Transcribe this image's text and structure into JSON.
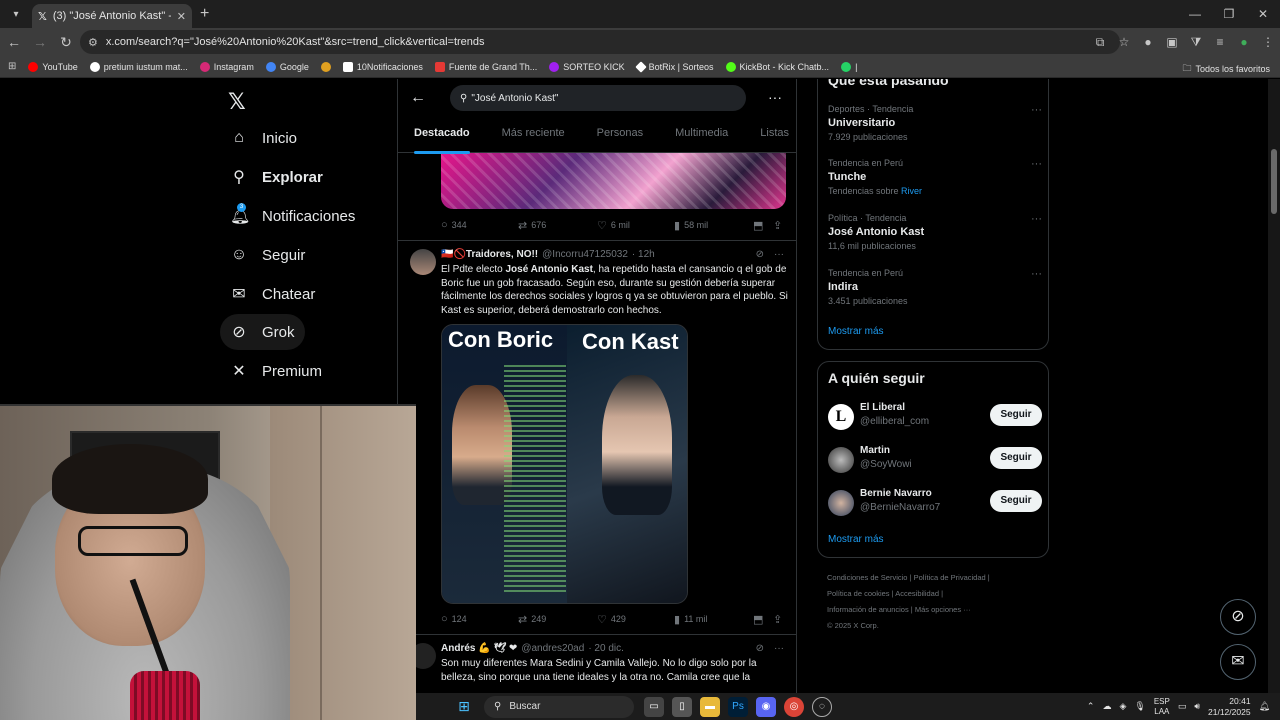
{
  "browser": {
    "tab_title": "(3) \"José Antonio Kast\" - Buscar",
    "url": "x.com/search?q=\"José%20Antonio%20Kast\"&src=trend_click&vertical=trends",
    "bookmarks": [
      "YouTube",
      "pretium iustum mat...",
      "Instagram",
      "Google",
      "10Notificaciones",
      "Fuente de Grand Th...",
      "SORTEO KICK",
      "BotRix | Sorteos",
      "KickBot - Kick Chatb..."
    ],
    "all_favorites": "Todos los favoritos"
  },
  "nav": {
    "items": [
      {
        "label": "Inicio",
        "icon": "home-icon"
      },
      {
        "label": "Explorar",
        "icon": "search-icon"
      },
      {
        "label": "Notificaciones",
        "icon": "bell-icon"
      },
      {
        "label": "Seguir",
        "icon": "follow-icon"
      },
      {
        "label": "Chatear",
        "icon": "mail-icon"
      },
      {
        "label": "Grok",
        "icon": "grok-icon"
      },
      {
        "label": "Premium",
        "icon": "x-icon"
      }
    ],
    "notif_count": "3"
  },
  "search": {
    "query": "\"José Antonio Kast\"",
    "tabs": [
      "Destacado",
      "Más reciente",
      "Personas",
      "Multimedia",
      "Listas"
    ]
  },
  "tweets": [
    {
      "replies": "344",
      "retweets": "676",
      "likes": "6 mil",
      "views": "58 mil"
    },
    {
      "name": "🇨🇱🚫Traidores, NO!!",
      "handle": "@Incorru47125032",
      "time": "· 12h",
      "text_pre": "El Pdte electo ",
      "text_bold": "José Antonio Kast",
      "text_post": ",  ha repetido hasta el cansancio q el gob de Boric fue un gob fracasado. Según eso, durante su gestión debería superar fácilmente los derechos sociales y logros q ya se obtuvieron para el pueblo. Si Kast es superior, deberá demostrarlo con hechos.",
      "media_left": "Con Boric",
      "media_right": "Con Kast",
      "replies": "124",
      "retweets": "249",
      "likes": "429",
      "views": "11 mil"
    },
    {
      "name": "Andrés 💪 🕊 ❤",
      "handle": "@andres20ad",
      "time": "· 20 dic.",
      "text": "Son muy diferentes Mara Sedini y Camila Vallejo. No lo digo solo por la belleza, sino porque una tiene ideales y la otra no. Camila cree que la"
    }
  ],
  "trends": {
    "title": "Qué está pasando",
    "items": [
      {
        "meta": "Deportes · Tendencia",
        "title": "Universitario",
        "count": "7.929 publicaciones"
      },
      {
        "meta": "Tendencia en Perú",
        "title": "Tunche",
        "count": "Tendencias sobre ",
        "link": "River"
      },
      {
        "meta": "Política · Tendencia",
        "title": "José Antonio Kast",
        "count": "11,6 mil publicaciones"
      },
      {
        "meta": "Tendencia en Perú",
        "title": "Indira",
        "count": "3.451 publicaciones"
      }
    ],
    "show_more": "Mostrar más"
  },
  "who_to_follow": {
    "title": "A quién seguir",
    "items": [
      {
        "name": "El Liberal",
        "handle": "@elliberal_com",
        "button": "Seguir"
      },
      {
        "name": "Martin",
        "handle": "@SoyWowi",
        "button": "Seguir"
      },
      {
        "name": "Bernie Navarro",
        "handle": "@BernieNavarro7",
        "button": "Seguir"
      }
    ],
    "show_more": "Mostrar más"
  },
  "footer": {
    "line1": "Condiciones de Servicio  |  Política de Privacidad  |",
    "line2": "Política de cookies  |  Accesibilidad  |",
    "line3": "Información de anuncios  |  Más opciones ···",
    "line4": "© 2025 X Corp."
  },
  "taskbar": {
    "search_label": "Buscar",
    "lang_top": "ESP",
    "lang_bottom": "LAA",
    "time": "20:41",
    "date": "21/12/2025"
  },
  "colors": {
    "accent": "#1d9bf0",
    "background": "#000000",
    "muted": "#71767b"
  }
}
